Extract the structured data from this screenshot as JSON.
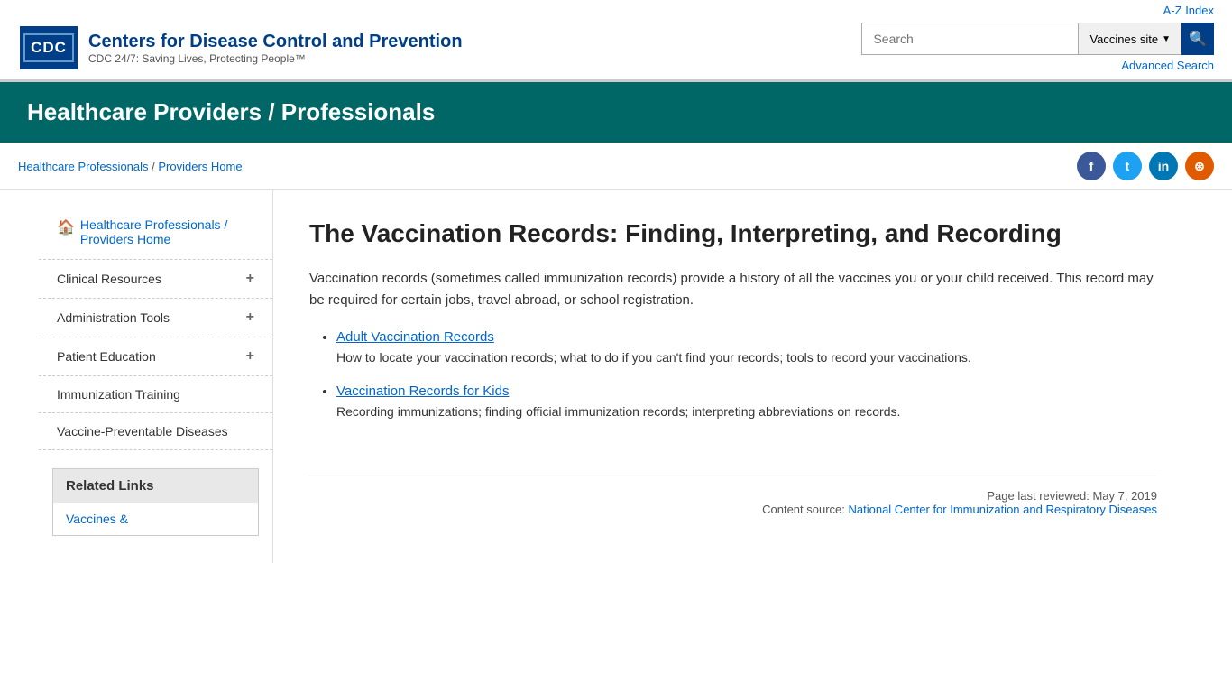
{
  "topbar": {
    "az_index": "A-Z Index",
    "logo_text": "CDC",
    "org_name": "Centers for Disease Control and Prevention",
    "tagline": "CDC 24/7: Saving Lives, Protecting People™",
    "search_placeholder": "Search",
    "search_scope": "Vaccines site",
    "advanced_search": "Advanced Search"
  },
  "banner": {
    "title": "Healthcare Providers / Professionals"
  },
  "breadcrumb": {
    "part1": "Healthcare Professionals",
    "separator": " / ",
    "part2": "Providers Home"
  },
  "sidebar": {
    "home_link": "Healthcare Professionals / Providers Home",
    "items": [
      {
        "label": "Clinical Resources",
        "has_plus": true
      },
      {
        "label": "Administration Tools",
        "has_plus": true
      },
      {
        "label": "Patient Education",
        "has_plus": true
      },
      {
        "label": "Immunization Training",
        "has_plus": false
      },
      {
        "label": "Vaccine-Preventable Diseases",
        "has_plus": false
      }
    ],
    "related_links_title": "Related Links",
    "related_link1": "Vaccines &"
  },
  "content": {
    "title": "The Vaccination Records: Finding, Interpreting, and Recording",
    "intro": "Vaccination records (sometimes called immunization records) provide a history of all the vaccines you or your child received. This record may be required for certain jobs, travel abroad, or school registration.",
    "links": [
      {
        "label": "Adult Vaccination Records",
        "description": "How to locate your vaccination records; what to do if you can't find your records; tools to record your vaccinations."
      },
      {
        "label": "Vaccination Records for Kids",
        "description": "Recording immunizations; finding official immunization records; interpreting abbreviations on records."
      }
    ],
    "footer_review": "Page last reviewed: May 7, 2019",
    "footer_source_label": "Content source: ",
    "footer_source_link": "National Center for Immunization and Respiratory Diseases"
  }
}
